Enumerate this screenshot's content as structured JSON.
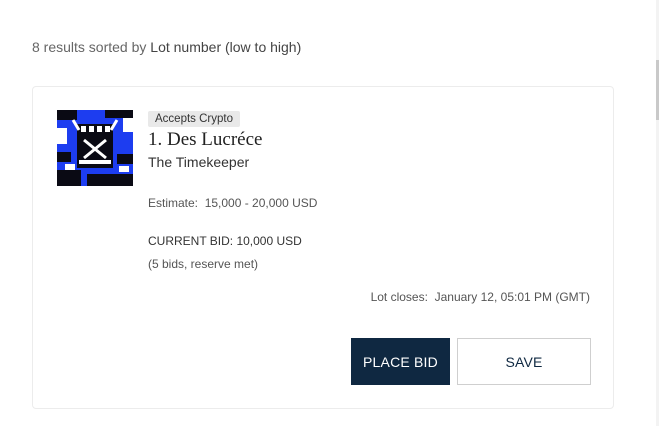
{
  "results": {
    "count_text": "8 results sorted by",
    "sort_label": "Lot number (low to high)"
  },
  "lot": {
    "badge": "Accepts Crypto",
    "title": "1. Des Lucréce",
    "subtitle": "The Timekeeper",
    "estimate_label": "Estimate:",
    "estimate_value": "15,000 - 20,000 USD",
    "current_bid": "CURRENT BID: 10,000 USD",
    "bid_info": "(5 bids, reserve met)",
    "closes_label": "Lot closes:",
    "closes_value": "January 12, 05:01 PM (GMT)",
    "thumbnail_icon": "artwork-thumbnail"
  },
  "actions": {
    "place_bid": "PLACE BID",
    "save": "SAVE"
  },
  "colors": {
    "primary": "#0f2841",
    "thumb_blue": "#1d3df0",
    "badge_bg": "#e9e9e9",
    "card_border": "#ececec"
  }
}
